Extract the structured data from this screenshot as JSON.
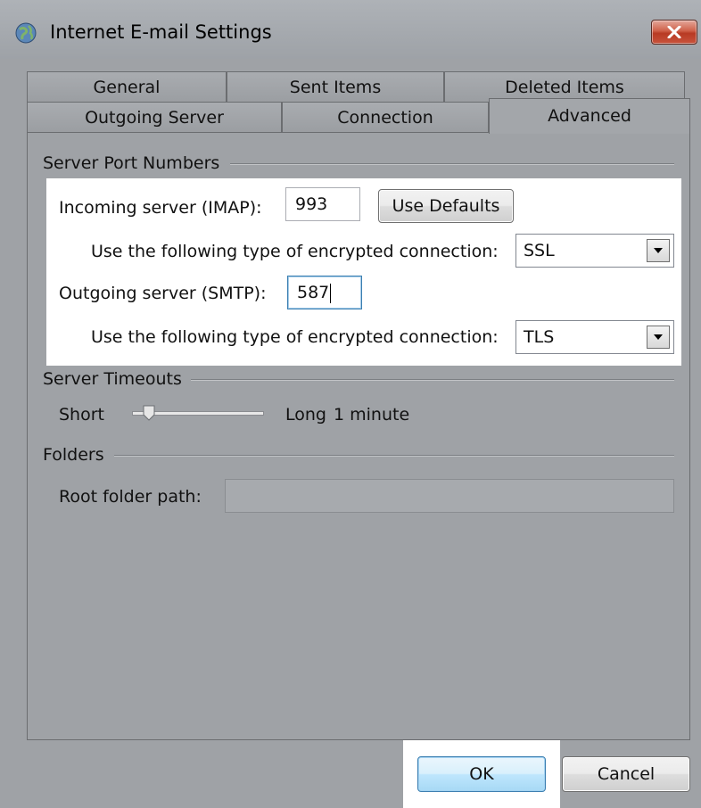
{
  "window": {
    "title": "Internet E-mail Settings",
    "icon": "globe-mail-icon",
    "close_icon": "close-x-icon"
  },
  "tabs": {
    "row_back": [
      "General",
      "Sent Items",
      "Deleted Items"
    ],
    "row_front": [
      "Outgoing Server",
      "Connection",
      "Advanced"
    ],
    "active": "Advanced"
  },
  "server_ports": {
    "group_label": "Server Port Numbers",
    "incoming_label": "Incoming server (IMAP):",
    "incoming_value": "993",
    "use_defaults_label": "Use Defaults",
    "incoming_encryption_label": "Use the following type of encrypted connection:",
    "incoming_encryption_value": "SSL",
    "outgoing_label": "Outgoing server (SMTP):",
    "outgoing_value": "587",
    "outgoing_encryption_label": "Use the following type of encrypted connection:",
    "outgoing_encryption_value": "TLS"
  },
  "timeouts": {
    "group_label": "Server Timeouts",
    "short_label": "Short",
    "long_label": "Long",
    "value_label": "1 minute"
  },
  "folders": {
    "group_label": "Folders",
    "root_label": "Root folder path:",
    "root_value": ""
  },
  "footer": {
    "ok_label": "OK",
    "cancel_label": "Cancel"
  },
  "colors": {
    "window_bg": "#9fa2a6",
    "highlight": "#ffffff",
    "close_button": "#c8533c",
    "focus_border": "#3c7fb1"
  }
}
